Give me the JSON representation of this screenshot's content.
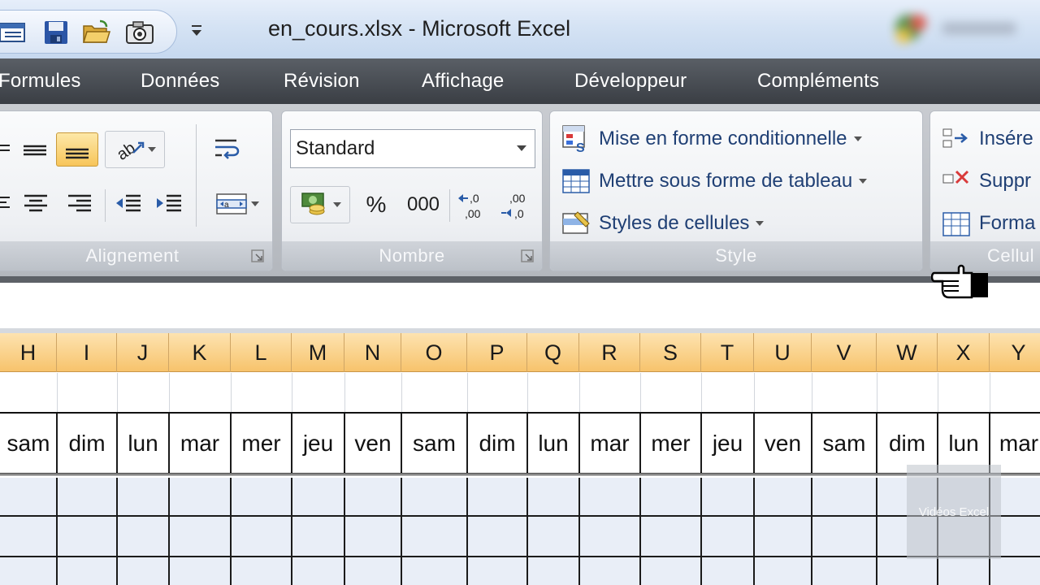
{
  "window": {
    "title": "en_cours.xlsx - Microsoft Excel"
  },
  "quick_access": [
    "view-icon",
    "save-icon",
    "open-folder-icon",
    "camera-icon"
  ],
  "tabs": [
    "Formules",
    "Données",
    "Révision",
    "Affichage",
    "Développeur",
    "Compléments"
  ],
  "ribbon": {
    "alignment": {
      "label": "Alignement"
    },
    "number": {
      "label": "Nombre",
      "format": "Standard",
      "percent": "%",
      "thousands": "000",
      "dec_increase": ",0\n,00",
      "dec_decrease": ",00\n,0"
    },
    "style": {
      "label": "Style",
      "conditional_formatting": "Mise en forme conditionnelle",
      "format_as_table": "Mettre sous forme de tableau",
      "cell_styles": "Styles de cellules"
    },
    "cells": {
      "label": "Cellul",
      "insert": "Insére",
      "delete": "Suppr",
      "format": "Forma"
    }
  },
  "sheet": {
    "columns": [
      "H",
      "I",
      "J",
      "K",
      "L",
      "M",
      "N",
      "O",
      "P",
      "Q",
      "R",
      "S",
      "T",
      "U",
      "V",
      "W",
      "X",
      "Y"
    ],
    "days": [
      "sam",
      "dim",
      "lun",
      "mar",
      "mer",
      "jeu",
      "ven",
      "sam",
      "dim",
      "lun",
      "mar",
      "mer",
      "jeu",
      "ven",
      "sam",
      "dim",
      "lun",
      "mar"
    ]
  },
  "watermark": "Vidéos Excel",
  "colors": {
    "tabbar": "#3a3e44",
    "header_gold": "#f7c36c",
    "ribbon_text": "#15428b"
  }
}
